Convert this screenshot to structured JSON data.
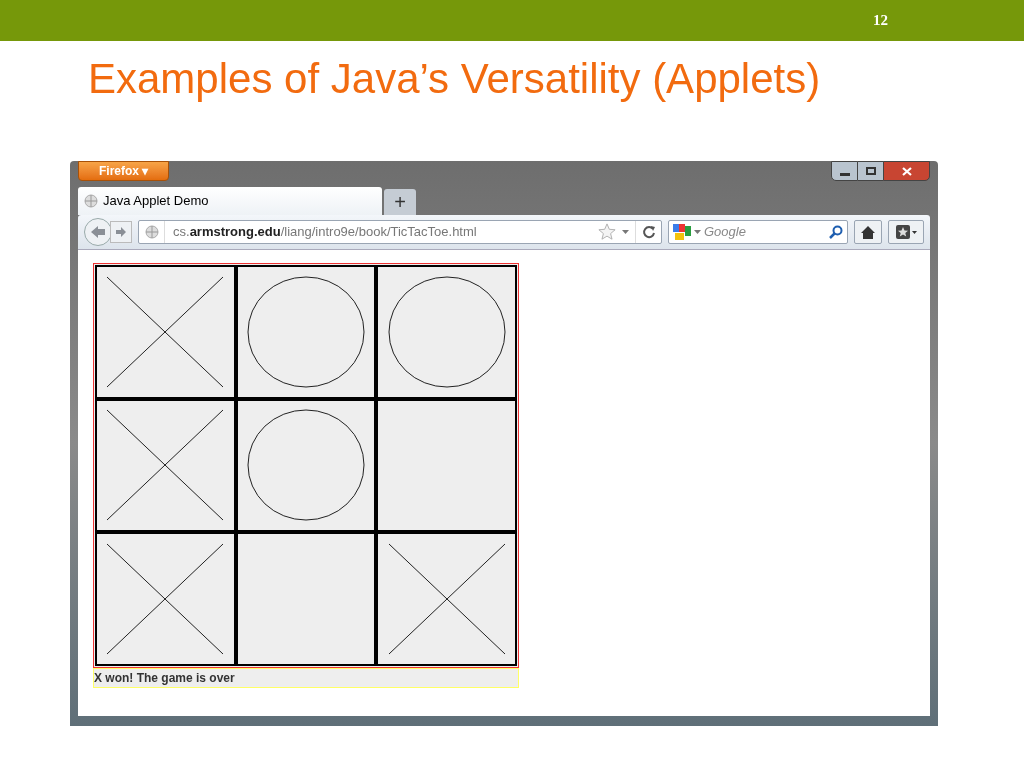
{
  "slide": {
    "number": "12",
    "title": "Examples of Java’s Versatility (Applets)"
  },
  "browser": {
    "menu_button": "Firefox ▾",
    "tabs": [
      {
        "label": "Java Applet Demo",
        "selected": true
      }
    ],
    "new_tab": "+",
    "url": "cs.**armstrong.edu**/liang/intro9e/book/TicTacToe.html",
    "search_placeholder": "Google"
  },
  "board": {
    "cells": [
      {
        "kind": "x"
      },
      {
        "kind": "o"
      },
      {
        "kind": "o"
      },
      {
        "kind": "x"
      },
      {
        "kind": "o"
      },
      {
        "kind": "empty"
      },
      {
        "kind": "x"
      },
      {
        "kind": "empty"
      },
      {
        "kind": "x"
      }
    ],
    "status": "X won! The game is over"
  }
}
